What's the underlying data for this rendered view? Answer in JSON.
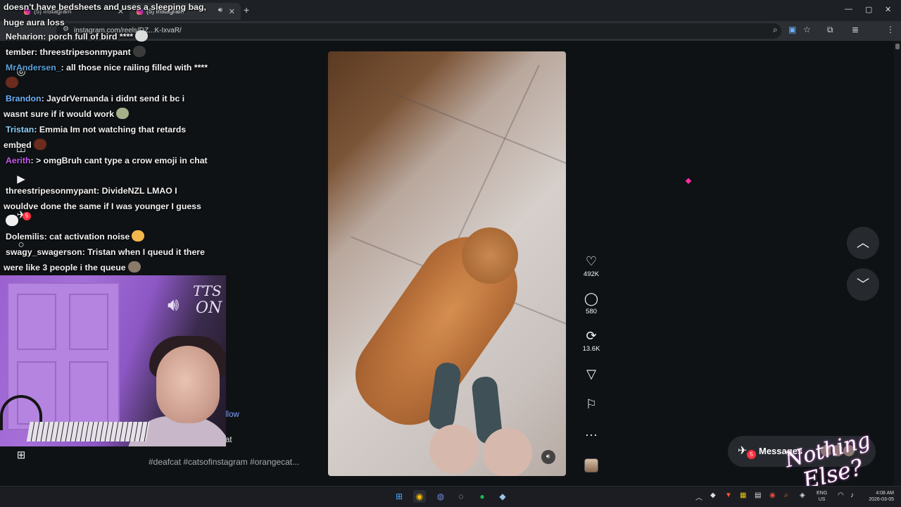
{
  "browser": {
    "tabs": [
      {
        "title": "(5) Instagram"
      },
      {
        "title": "(5) Instagram"
      }
    ],
    "new_tab": "+",
    "url": "instagram.com/reels/DZ...K-IxvaR/",
    "window_controls": [
      "—",
      "▢",
      "✕"
    ]
  },
  "reel": {
    "likes": "492K",
    "comments": "580",
    "reposts": "13.6K",
    "caption": "#deafcat #catsofinstagram #orangecat...",
    "follow_snip": "llow",
    "cat_snip": "at"
  },
  "messages": {
    "label": "Messages",
    "badge": "5"
  },
  "sidebar": {
    "notification_badge": "5"
  },
  "chat": [
    {
      "user": "",
      "text": "doesn't have bedsheets and uses a sleeping bag, huge aura loss",
      "user_color": "#f2f2f2",
      "emote": ""
    },
    {
      "user": "Neharion",
      "text": ": porch full of bird ****",
      "user_color": "#f2f2f2",
      "emote": "#dcdcdc"
    },
    {
      "user": "tember",
      "text": ": threestripesonmypant",
      "user_color": "#f2f2f2",
      "emote": "#3b3b3b"
    },
    {
      "user": "MrAndersen_",
      "text": ": all those nice railing filled with ****",
      "user_color": "#5aa6e0",
      "emote": "#6b2b1d"
    },
    {
      "user": "Brandon",
      "text": ": JaydrVernanda i didnt send it bc i wasnt sure if it would work",
      "user_color": "#6fb4ff",
      "emote": "#a5b088"
    },
    {
      "user": "Tristan",
      "text": ": Emmia Im not watching that retards embed",
      "user_color": "#8fd3ff",
      "emote": "#6b2b1d"
    },
    {
      "user": "Aerith",
      "text": ": > omgBruh cant type a crow emoji in chat",
      "user_color": "#c65df0",
      "emote": ""
    },
    {
      "user": "threestripesonmypant",
      "text": ": DivideNZL LMAO I wouldve done the same if I was younger I guess",
      "user_color": "#f2f2f2",
      "emote": "#f0f0f0"
    },
    {
      "user": "Dolemilis",
      "text": ": cat activation noise",
      "user_color": "#f2f2f2",
      "emote": "#f2b84b"
    },
    {
      "user": "swagy_swagerson",
      "text": ": Tristan when I queud it there were like 3 people i the queue",
      "user_color": "#f2f2f2",
      "emote": "#8a7a6a"
    }
  ],
  "overlay": {
    "tts_line1": "TTS",
    "tts_line2": "ON",
    "brand_line1": "Nothing",
    "brand_line2": "Else?"
  },
  "taskbar": {
    "language": [
      "ENG",
      "US"
    ],
    "time": "4:08 AM",
    "date": "2026-03-05"
  },
  "colors": {
    "page_bg": "#0f1215",
    "chrome_bg": "#2c3035",
    "badge_red": "#ff3040",
    "link_blue": "#7fa0ff"
  },
  "icons": [
    "heart-icon",
    "comment-icon",
    "repost-icon",
    "share-icon",
    "bookmark-icon",
    "more-icon",
    "chevron-up-icon",
    "chevron-down-icon",
    "messages-icon"
  ]
}
